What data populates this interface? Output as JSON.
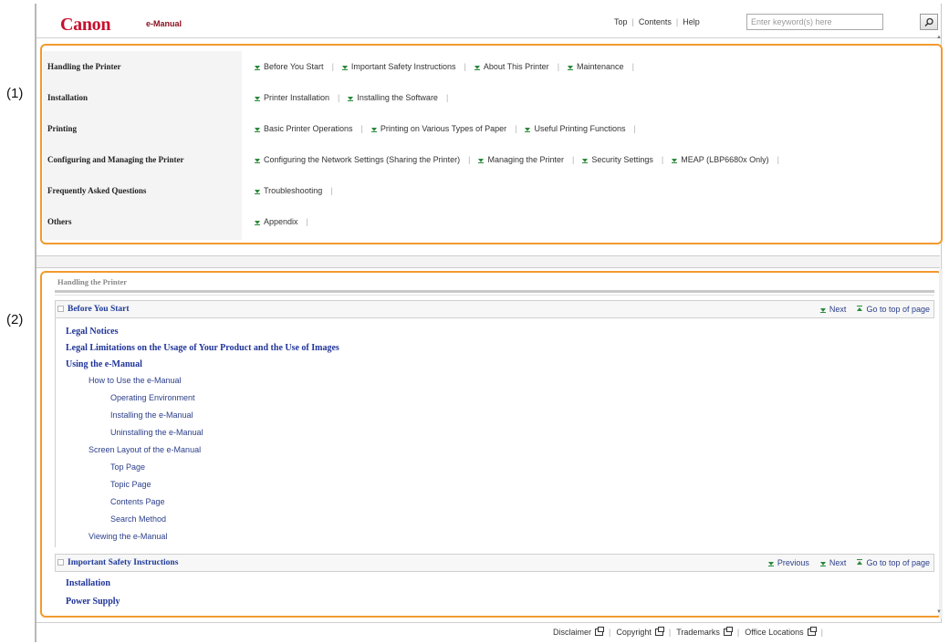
{
  "callouts": {
    "one": "(1)",
    "two": "(2)"
  },
  "header": {
    "logo": "Canon",
    "subtitle": "e-Manual",
    "nav": [
      "Top",
      "Contents",
      "Help"
    ],
    "search_placeholder": "Enter keyword(s) here"
  },
  "nav_table": [
    {
      "category": "Handling the Printer",
      "links": [
        "Before You Start",
        "Important Safety Instructions",
        "About This Printer",
        "Maintenance"
      ]
    },
    {
      "category": "Installation",
      "links": [
        "Printer Installation",
        "Installing the Software"
      ]
    },
    {
      "category": "Printing",
      "links": [
        "Basic Printer Operations",
        "Printing on Various Types of Paper",
        "Useful Printing Functions"
      ]
    },
    {
      "category": "Configuring and Managing the Printer",
      "links": [
        "Configuring the Network Settings (Sharing the Printer)",
        "Managing the Printer",
        "Security Settings",
        "MEAP (LBP6680x Only)"
      ]
    },
    {
      "category": "Frequently Asked Questions",
      "links": [
        "Troubleshooting"
      ]
    },
    {
      "category": "Others",
      "links": [
        "Appendix"
      ]
    }
  ],
  "section": {
    "title": "Handling the Printer",
    "groups": [
      {
        "title": "Before You Start",
        "nav": [
          "Next",
          "Go to top of page"
        ]
      },
      {
        "title": "Important Safety Instructions",
        "nav": [
          "Previous",
          "Next",
          "Go to top of page"
        ]
      }
    ],
    "toc_before": [
      "Legal Notices",
      "Legal Limitations on the Usage of Your Product and the Use of Images",
      "Using the e-Manual",
      "How to Use the e-Manual",
      "Operating Environment",
      "Installing the e-Manual",
      "Uninstalling the e-Manual",
      "Screen Layout of the e-Manual",
      "Top Page",
      "Topic Page",
      "Contents Page",
      "Search Method",
      "Viewing the e-Manual"
    ],
    "toc_safety": [
      "Installation",
      "Power Supply"
    ]
  },
  "footer": {
    "links": [
      "Disclaimer",
      "Copyright",
      "Trademarks",
      "Office Locations"
    ]
  },
  "colors": {
    "highlight": "#f29a2e",
    "brand": "#c8102e",
    "link": "#1f3a99",
    "arrow": "#2a8a3a"
  }
}
